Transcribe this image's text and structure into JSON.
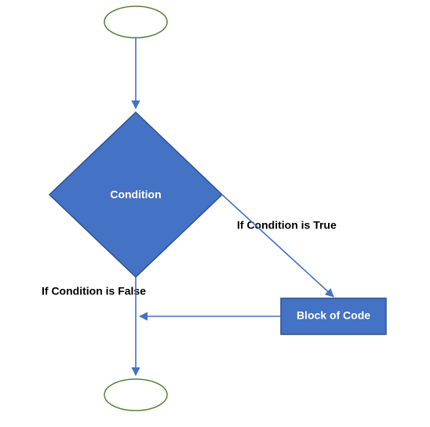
{
  "diagram": {
    "condition_label": "Condition",
    "block_label": "Block of Code",
    "true_label": "If Condition is True",
    "false_label": "If Condition is False"
  },
  "colors": {
    "blue_fill": "#4472C4",
    "blue_stroke": "#2F528F",
    "green_stroke": "#548235"
  }
}
